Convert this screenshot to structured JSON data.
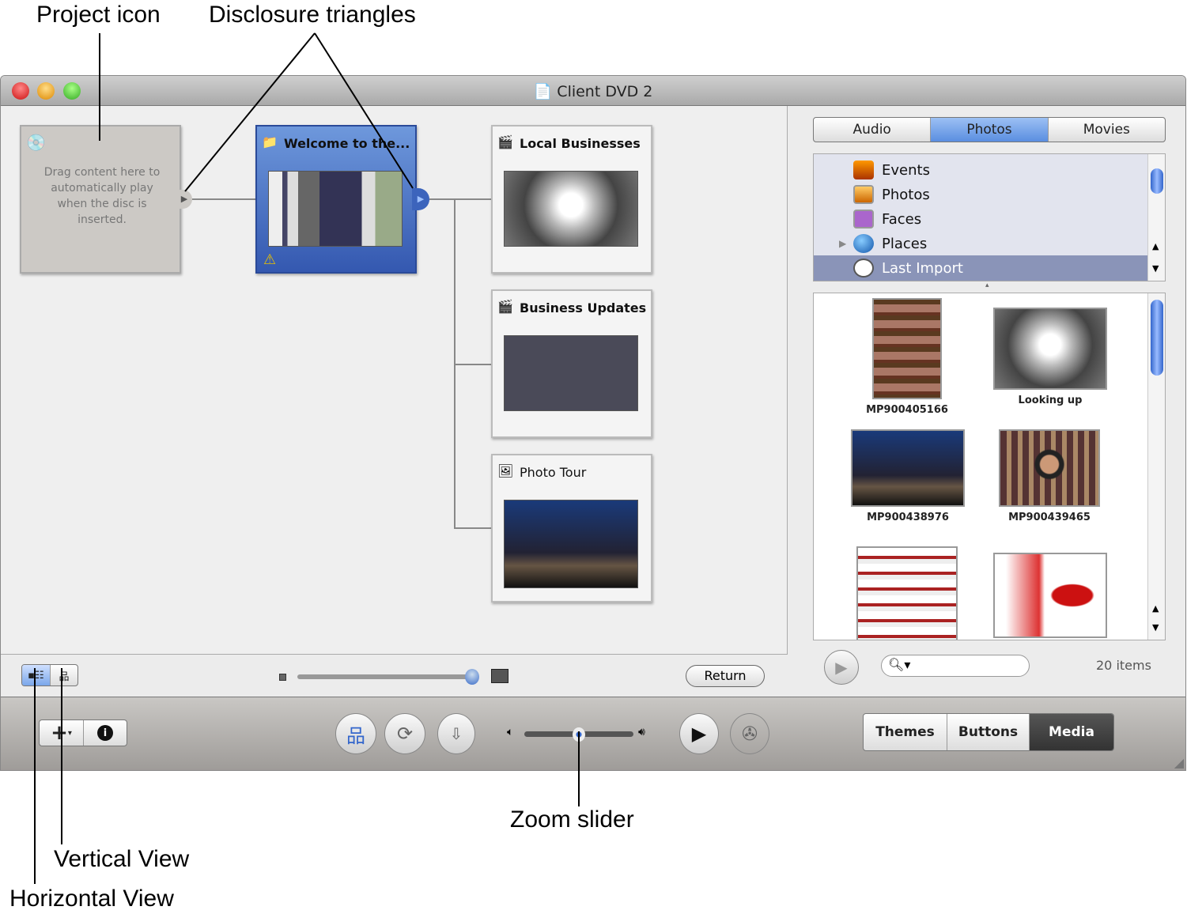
{
  "callouts": {
    "project_icon": "Project icon",
    "disclosure": "Disclosure triangles",
    "zoom_slider": "Zoom slider",
    "vertical_view": "Vertical View",
    "horizontal_view": "Horizontal View"
  },
  "window": {
    "title": "Client DVD 2"
  },
  "project_node": {
    "text": "Drag content here to automatically play when the disc is inserted."
  },
  "menu_node": {
    "title": "Welcome to the..."
  },
  "child_nodes": [
    {
      "title": "Local Businesses"
    },
    {
      "title": "Business Updates"
    },
    {
      "title": "Photo Tour"
    }
  ],
  "strip": {
    "return_label": "Return",
    "map_zoom_percent": 100
  },
  "media": {
    "tabs": [
      {
        "label": "Audio"
      },
      {
        "label": "Photos",
        "selected": true
      },
      {
        "label": "Movies"
      }
    ],
    "sources": [
      {
        "label": "Events",
        "icon": "events-icon"
      },
      {
        "label": "Photos",
        "icon": "photos-icon"
      },
      {
        "label": "Faces",
        "icon": "faces-icon"
      },
      {
        "label": "Places",
        "icon": "globe-icon"
      },
      {
        "label": "Last Import",
        "icon": "clock-icon",
        "selected": true
      }
    ],
    "items": [
      {
        "label": "MP900405166"
      },
      {
        "label": "Looking up"
      },
      {
        "label": "MP900438976"
      },
      {
        "label": "MP900439465"
      },
      {
        "label": ""
      },
      {
        "label": ""
      }
    ],
    "count": "20 items",
    "search_placeholder": ""
  },
  "toolbar": {
    "volume_percent": 50,
    "tabs": [
      {
        "label": "Themes"
      },
      {
        "label": "Buttons"
      },
      {
        "label": "Media",
        "selected": true
      }
    ]
  },
  "colors": {
    "accent": "#4a78c8",
    "selected_source": "#8a94b8"
  }
}
